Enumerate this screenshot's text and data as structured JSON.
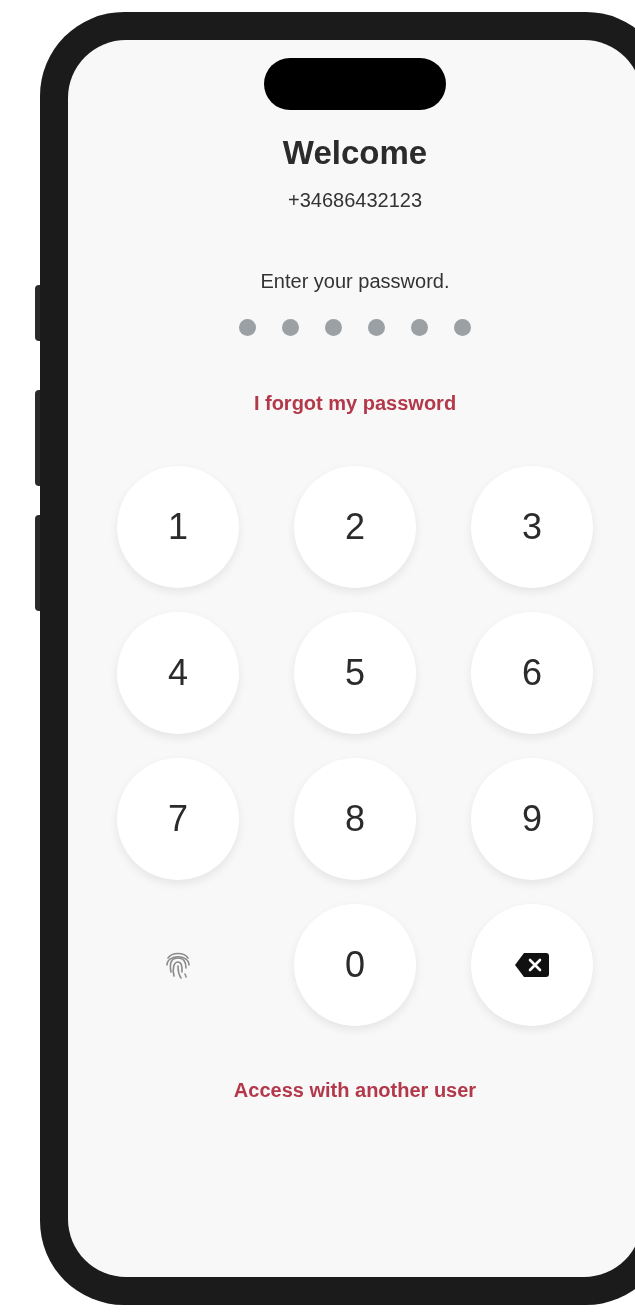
{
  "title": "Welcome",
  "phone_number": "+34686432123",
  "prompt": "Enter your password.",
  "pin_dots": [
    {
      "filled": false
    },
    {
      "filled": false
    },
    {
      "filled": false
    },
    {
      "filled": false
    },
    {
      "filled": false
    },
    {
      "filled": false
    }
  ],
  "forgot_link": "I forgot my password",
  "keypad": [
    {
      "kind": "digit",
      "label": "1"
    },
    {
      "kind": "digit",
      "label": "2"
    },
    {
      "kind": "digit",
      "label": "3"
    },
    {
      "kind": "digit",
      "label": "4"
    },
    {
      "kind": "digit",
      "label": "5"
    },
    {
      "kind": "digit",
      "label": "6"
    },
    {
      "kind": "digit",
      "label": "7"
    },
    {
      "kind": "digit",
      "label": "8"
    },
    {
      "kind": "digit",
      "label": "9"
    },
    {
      "kind": "biometric"
    },
    {
      "kind": "digit",
      "label": "0"
    },
    {
      "kind": "delete"
    }
  ],
  "other_user_link": "Access with another user"
}
